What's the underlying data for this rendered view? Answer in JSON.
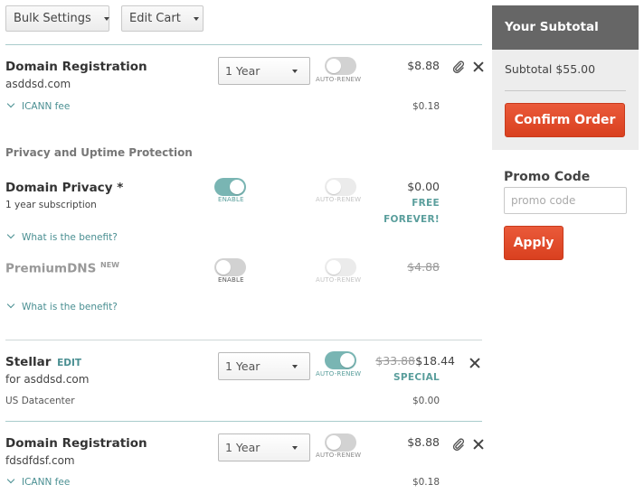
{
  "toolbar": {
    "bulk_settings": "Bulk Settings",
    "edit_cart": "Edit Cart"
  },
  "item1": {
    "title": "Domain Registration",
    "domain": "asddsd.com",
    "term": "1 Year",
    "autorenew_label": "AUTO-RENEW",
    "price": "$8.88",
    "fee_label": "ICANN fee",
    "fee_price": "$0.18"
  },
  "privacy_section": {
    "heading": "Privacy and Uptime Protection",
    "privacy": {
      "title": "Domain Privacy *",
      "subtitle": "1 year subscription",
      "enable_label": "ENABLE",
      "autorenew_label": "AUTO-RENEW",
      "price": "$0.00",
      "free_line1": "FREE",
      "free_line2": "FOREVER!",
      "benefit_link": "What is the benefit?"
    },
    "premiumdns": {
      "title": "PremiumDNS",
      "badge": "NEW",
      "enable_label": "ENABLE",
      "autorenew_label": "AUTO-RENEW",
      "price": "$4.88",
      "benefit_link": "What is the benefit?"
    }
  },
  "item2": {
    "title": "Stellar",
    "edit_label": "EDIT",
    "subtitle": "for asddsd.com",
    "term": "1 Year",
    "autorenew_label": "AUTO-RENEW",
    "old_price": "$33.88",
    "price": "$18.44",
    "special_label": "SPECIAL",
    "datacenter": "US Datacenter",
    "datacenter_price": "$0.00"
  },
  "item3": {
    "title": "Domain Registration",
    "domain": "fdsdfdsf.com",
    "term": "1 Year",
    "autorenew_label": "AUTO-RENEW",
    "price": "$8.88",
    "fee_label": "ICANN fee",
    "fee_price": "$0.18"
  },
  "sidebar": {
    "heading": "Your Subtotal",
    "subtotal": "Subtotal $55.00",
    "confirm": "Confirm Order",
    "promo_label": "Promo Code",
    "promo_placeholder": "promo code",
    "apply": "Apply"
  },
  "colors": {
    "accent_teal": "#79b5b3",
    "confirm_red": "#e04a2a",
    "sidebar_head": "#666666"
  },
  "icons": {
    "attachment": "paperclip-icon",
    "remove": "close-icon",
    "expand": "chevron-down-icon",
    "dropdown": "caret-down-icon"
  },
  "toggles": {
    "item1_autorenew": false,
    "privacy_enable": true,
    "privacy_autorenew": false,
    "premiumdns_enable": false,
    "premiumdns_autorenew": false,
    "item2_autorenew": true,
    "item3_autorenew": false
  }
}
